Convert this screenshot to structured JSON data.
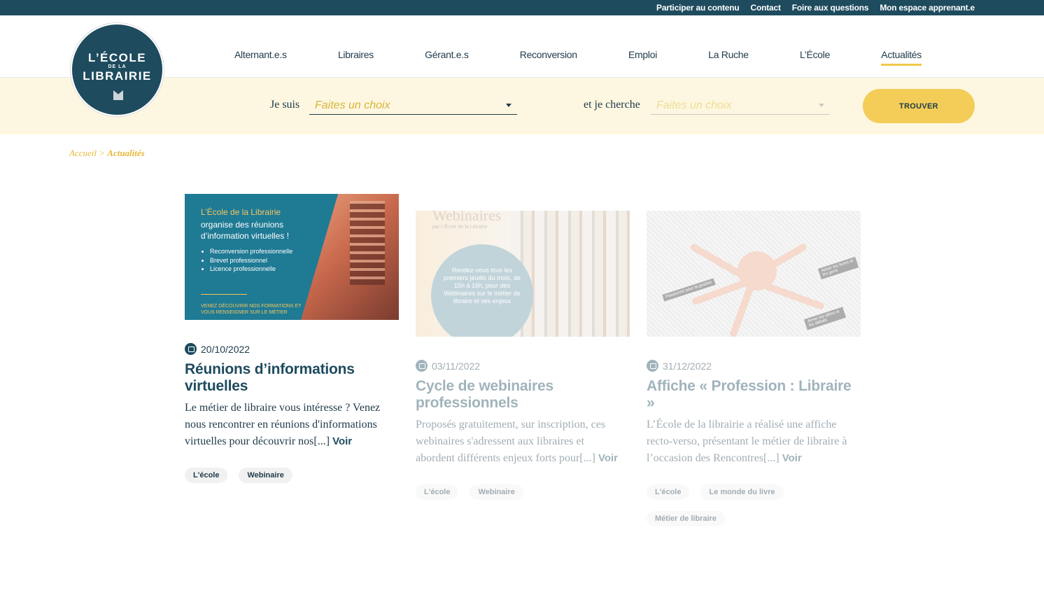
{
  "topbar": {
    "links": [
      "Participer au contenu",
      "Contact",
      "Foire aux questions",
      "Mon espace apprenant.e"
    ]
  },
  "logo": {
    "line1": "L’ÉCOLE",
    "line2": "DE LA",
    "line3": "LIBRAIRIE"
  },
  "nav": {
    "items": [
      "Alternant.e.s",
      "Libraires",
      "Gérant.e.s",
      "Reconversion",
      "Emploi",
      "La Ruche",
      "L’École",
      "Actualités"
    ],
    "active": "Actualités"
  },
  "search": {
    "label_1": "Je suis",
    "select_1": "Faites un choix",
    "label_2": "et je cherche",
    "select_2": "Faites un choix",
    "button": "TROUVER"
  },
  "breadcrumb": {
    "home": "Accueil",
    "sep": ">",
    "current": "Actualités"
  },
  "articles": [
    {
      "date": "20/10/2022",
      "title": "Réunions d’informations virtuelles",
      "excerpt": "Le métier de libraire vous intéresse ? Venez nous rencontrer en réunions d'informations virtuelles pour découvrir nos[...]",
      "more": "Voir",
      "tags": [
        "L'école",
        "Webinaire"
      ],
      "thumb": {
        "title": "L’École de la Librairie",
        "subtitle": "organise des réunions d’information virtuelles !",
        "bullets": [
          "Reconversion professionnelle",
          "Brevet professionnel",
          "Licence professionnelle"
        ],
        "cta": "VENEZ DÉCOUVRIR NOS FORMATIONS ET VOUS RENSEIGNER SUR LE MÉTIER"
      }
    },
    {
      "date": "03/11/2022",
      "title": "Cycle de webinaires professionnels",
      "excerpt": "Proposés gratuitement, sur inscription, ces webinaires s'adressent aux libraires et abordent différents enjeux forts pour[...]",
      "more": "Voir",
      "tags": [
        "L'école",
        "Webinaire"
      ],
      "thumb": {
        "title": "Webinaires",
        "subtitle": "par L’École de la Librairie",
        "circle": "Rendez-vous tous les premiers jeudis du mois, de 15h à 16h, pour des Webinaires sur le métier de libraire et ses enjeux"
      }
    },
    {
      "date": "31/12/2022",
      "title": "Affiche « Profession : Libraire »",
      "excerpt": "L’École de la librairie a réalisé une affiche recto-verso, présentant le métier de libraire à l’occasion des Rencontres[...]",
      "more": "Voir",
      "tags": [
        "L'école",
        "Le monde du livre",
        "Métier de libraire"
      ],
      "thumb": {
        "label_1": "Passionné pour la gestion",
        "label_2": "Aimer les livres et les gens",
        "label_3": "Aimer les idées et les débats"
      }
    }
  ],
  "colors": {
    "primary": "#1e4b5e",
    "accent": "#f3cd58",
    "band": "#fdf7e1"
  }
}
